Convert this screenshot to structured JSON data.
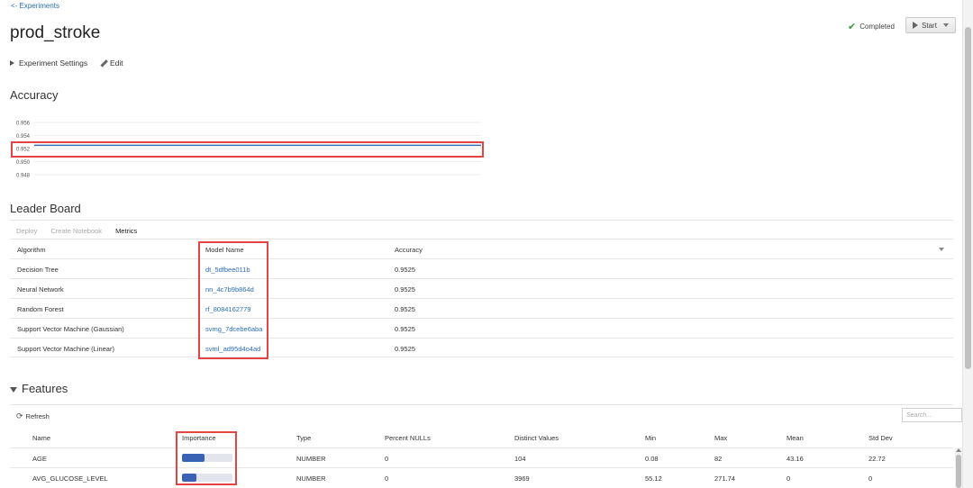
{
  "nav": {
    "back_label": "<- Experiments"
  },
  "header": {
    "title": "prod_stroke",
    "status_label": "Completed",
    "start_label": "Start",
    "settings_label": "Experiment Settings",
    "edit_label": "Edit"
  },
  "accuracy": {
    "title": "Accuracy",
    "chart_data": {
      "type": "line",
      "title": "",
      "xlabel": "",
      "ylabel": "",
      "y_ticks": [
        "0.956",
        "0.954",
        "0.952",
        "0.950",
        "0.948"
      ],
      "ylim": [
        0.948,
        0.956
      ],
      "series": [
        {
          "values": [
            0.9525,
            0.9525
          ],
          "color": "#3b6db3"
        }
      ],
      "grid": true
    }
  },
  "leaderboard": {
    "title": "Leader Board",
    "tabs": [
      "Deploy",
      "Create Notebook",
      "Metrics"
    ],
    "columns": [
      "Algorithm",
      "Model Name",
      "Accuracy"
    ],
    "rows": [
      {
        "algorithm": "Decision Tree",
        "model": "dt_5dfbee011b",
        "accuracy": "0.9525"
      },
      {
        "algorithm": "Neural Network",
        "model": "nn_4c7b9b864d",
        "accuracy": "0.9525"
      },
      {
        "algorithm": "Random Forest",
        "model": "rf_8084162779",
        "accuracy": "0.9525"
      },
      {
        "algorithm": "Support Vector Machine (Gaussian)",
        "model": "svmg_7dcebe6aba",
        "accuracy": "0.9525"
      },
      {
        "algorithm": "Support Vector Machine (Linear)",
        "model": "svml_ad95d4o4ad",
        "accuracy": "0.9525"
      }
    ]
  },
  "features": {
    "title": "Features",
    "refresh_label": "Refresh",
    "search_placeholder": "Search...",
    "columns": [
      "Name",
      "Importance",
      "Type",
      "Percent NULLs",
      "Distinct Values",
      "Min",
      "Max",
      "Mean",
      "Std Dev"
    ],
    "rows": [
      {
        "name": "AGE",
        "importance": 0.45,
        "type": "NUMBER",
        "nulls": "0",
        "distinct": "104",
        "min": "0.08",
        "max": "82",
        "mean": "43.16",
        "std": "22.72"
      },
      {
        "name": "AVG_GLUCOSE_LEVEL",
        "importance": 0.28,
        "type": "NUMBER",
        "nulls": "0",
        "distinct": "3969",
        "min": "55.12",
        "max": "271.74",
        "mean": "0",
        "std": "0"
      }
    ]
  },
  "colors": {
    "accent": "#2a6ebb",
    "highlight": "#e34545",
    "bar": "#3a62b4"
  }
}
